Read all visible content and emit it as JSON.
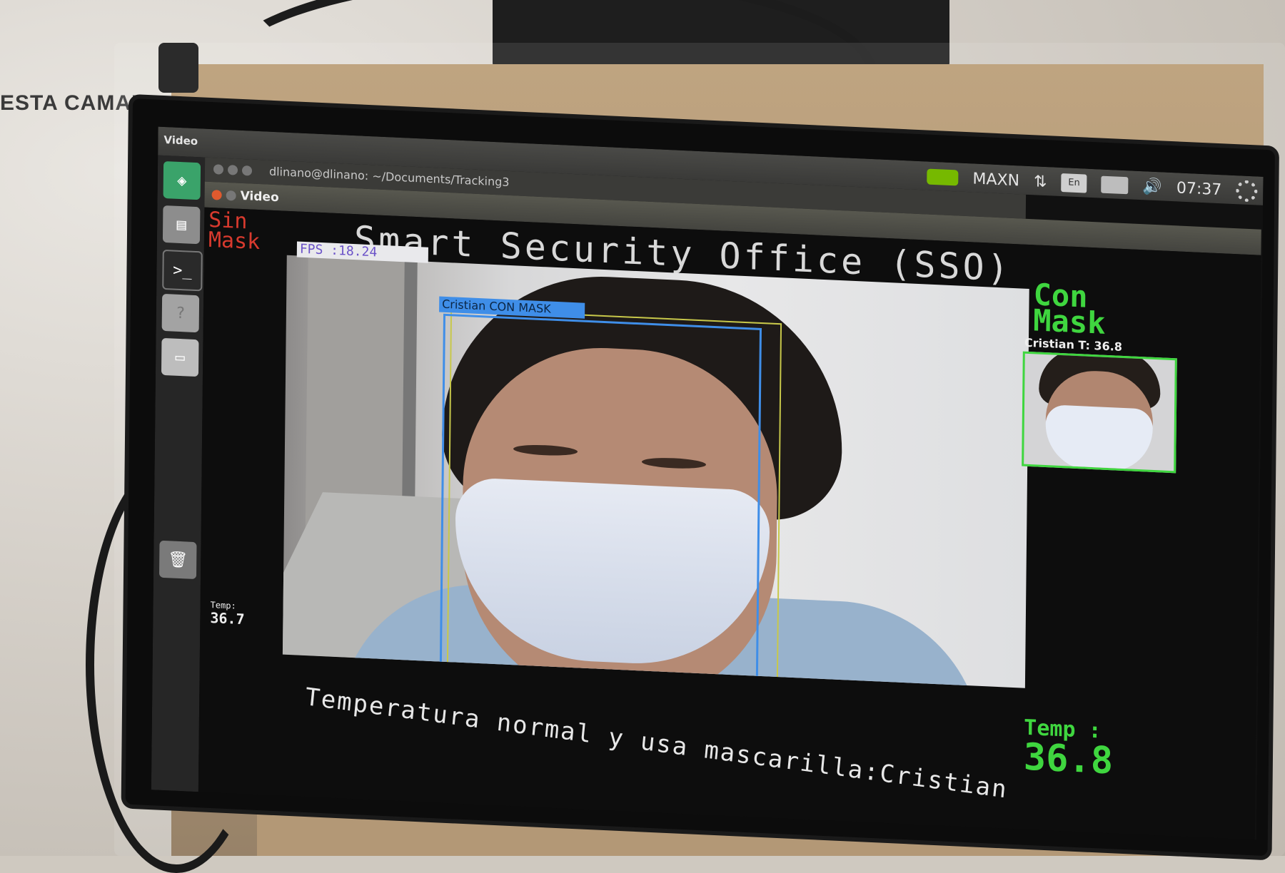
{
  "wall_label": "ESTA CAMAR",
  "topbar": {
    "app_title": "Video",
    "power_mode": "MAXN",
    "keyboard_layout": "En",
    "clock": "07:37"
  },
  "terminal_window": {
    "title": "dlinano@dlinano: ~/Documents/Tracking3"
  },
  "video_window": {
    "title": "Video",
    "header_title": "Smart Security Office (SSO)",
    "sin_mask_label": [
      "Sin",
      "Mask"
    ],
    "fps_text": "FPS  :18.24",
    "left_temp_label": "Temp:",
    "left_temp_value": "36.7",
    "detection_label": "Cristian CON MASK",
    "con_mask_label": [
      "Con",
      "Mask"
    ],
    "thumbnail_caption": "Cristian T: 36.8",
    "status_message": "Temperatura normal y usa mascarilla:Cristian",
    "right_temp_label": "Temp :",
    "right_temp_value": "36.8"
  },
  "colors": {
    "sin_mask": "#d83a2e",
    "con_mask": "#3fd63f",
    "bbox": "#3f8ee8",
    "fps_text": "#6b52c8",
    "nvidia": "#76b900"
  },
  "launcher": {
    "icons": [
      "home-icon",
      "files-icon",
      "terminal-icon",
      "help-icon",
      "disk-icon",
      "trash-icon"
    ]
  }
}
